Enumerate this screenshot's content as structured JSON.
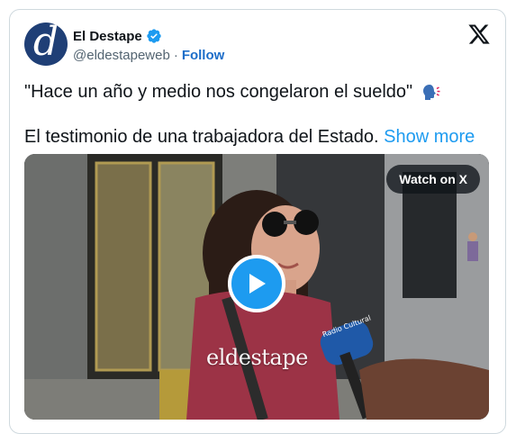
{
  "author": {
    "display_name": "El Destape",
    "handle": "@eldestapeweb",
    "separator": "·",
    "follow_label": "Follow",
    "avatar_letter": "d"
  },
  "tweet": {
    "line1": "\"Hace un año y medio nos congelaron el sueldo\"",
    "line2": "El testimonio de una trabajadora del Estado.",
    "show_more_label": "Show more"
  },
  "media": {
    "watch_label": "Watch on X",
    "watermark": "eldestape",
    "mic_label": "Radio Cultural"
  },
  "colors": {
    "accent": "#1d9bf0",
    "follow": "#1d6ec9",
    "brand": "#1f3f76"
  },
  "icons": [
    "verified-badge-icon",
    "x-logo-icon",
    "speaking-head-icon",
    "play-icon"
  ]
}
